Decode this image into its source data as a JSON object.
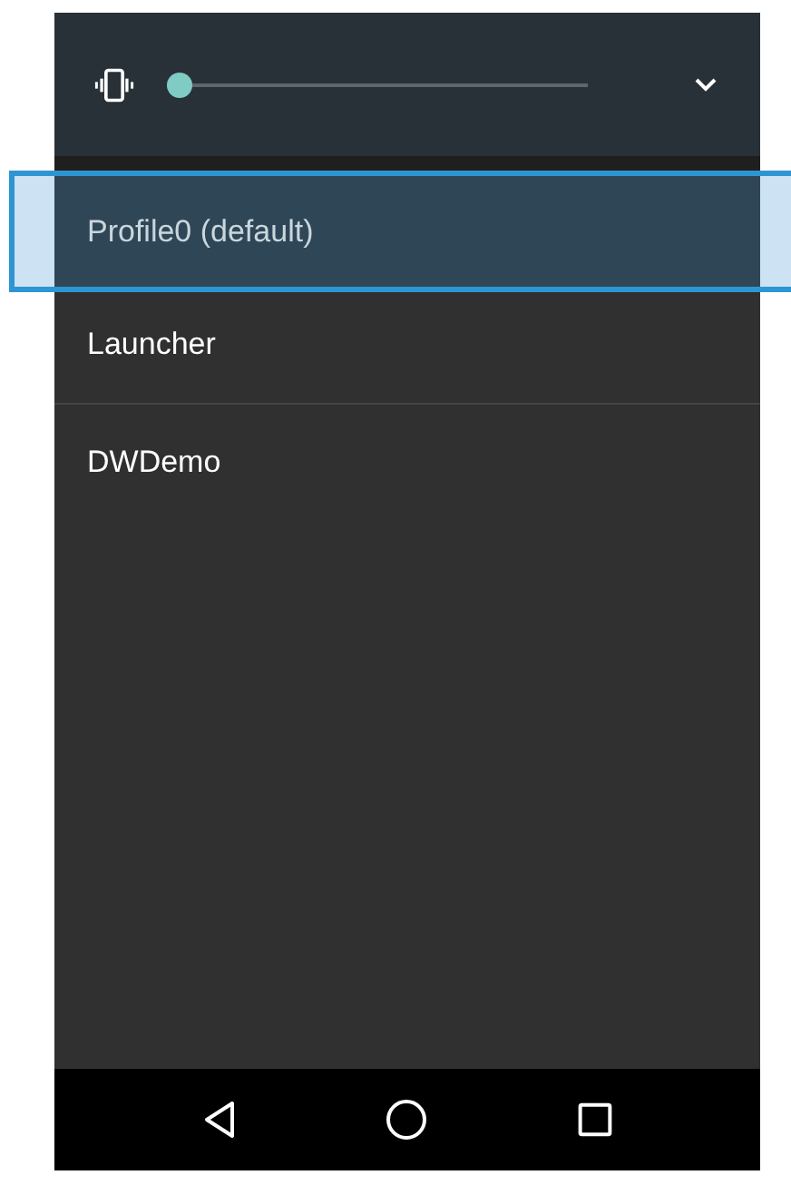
{
  "volume": {
    "level": 0
  },
  "profiles": [
    {
      "label": "Profile0 (default)",
      "selected": true
    },
    {
      "label": "Launcher",
      "selected": false
    },
    {
      "label": "DWDemo",
      "selected": false
    }
  ]
}
